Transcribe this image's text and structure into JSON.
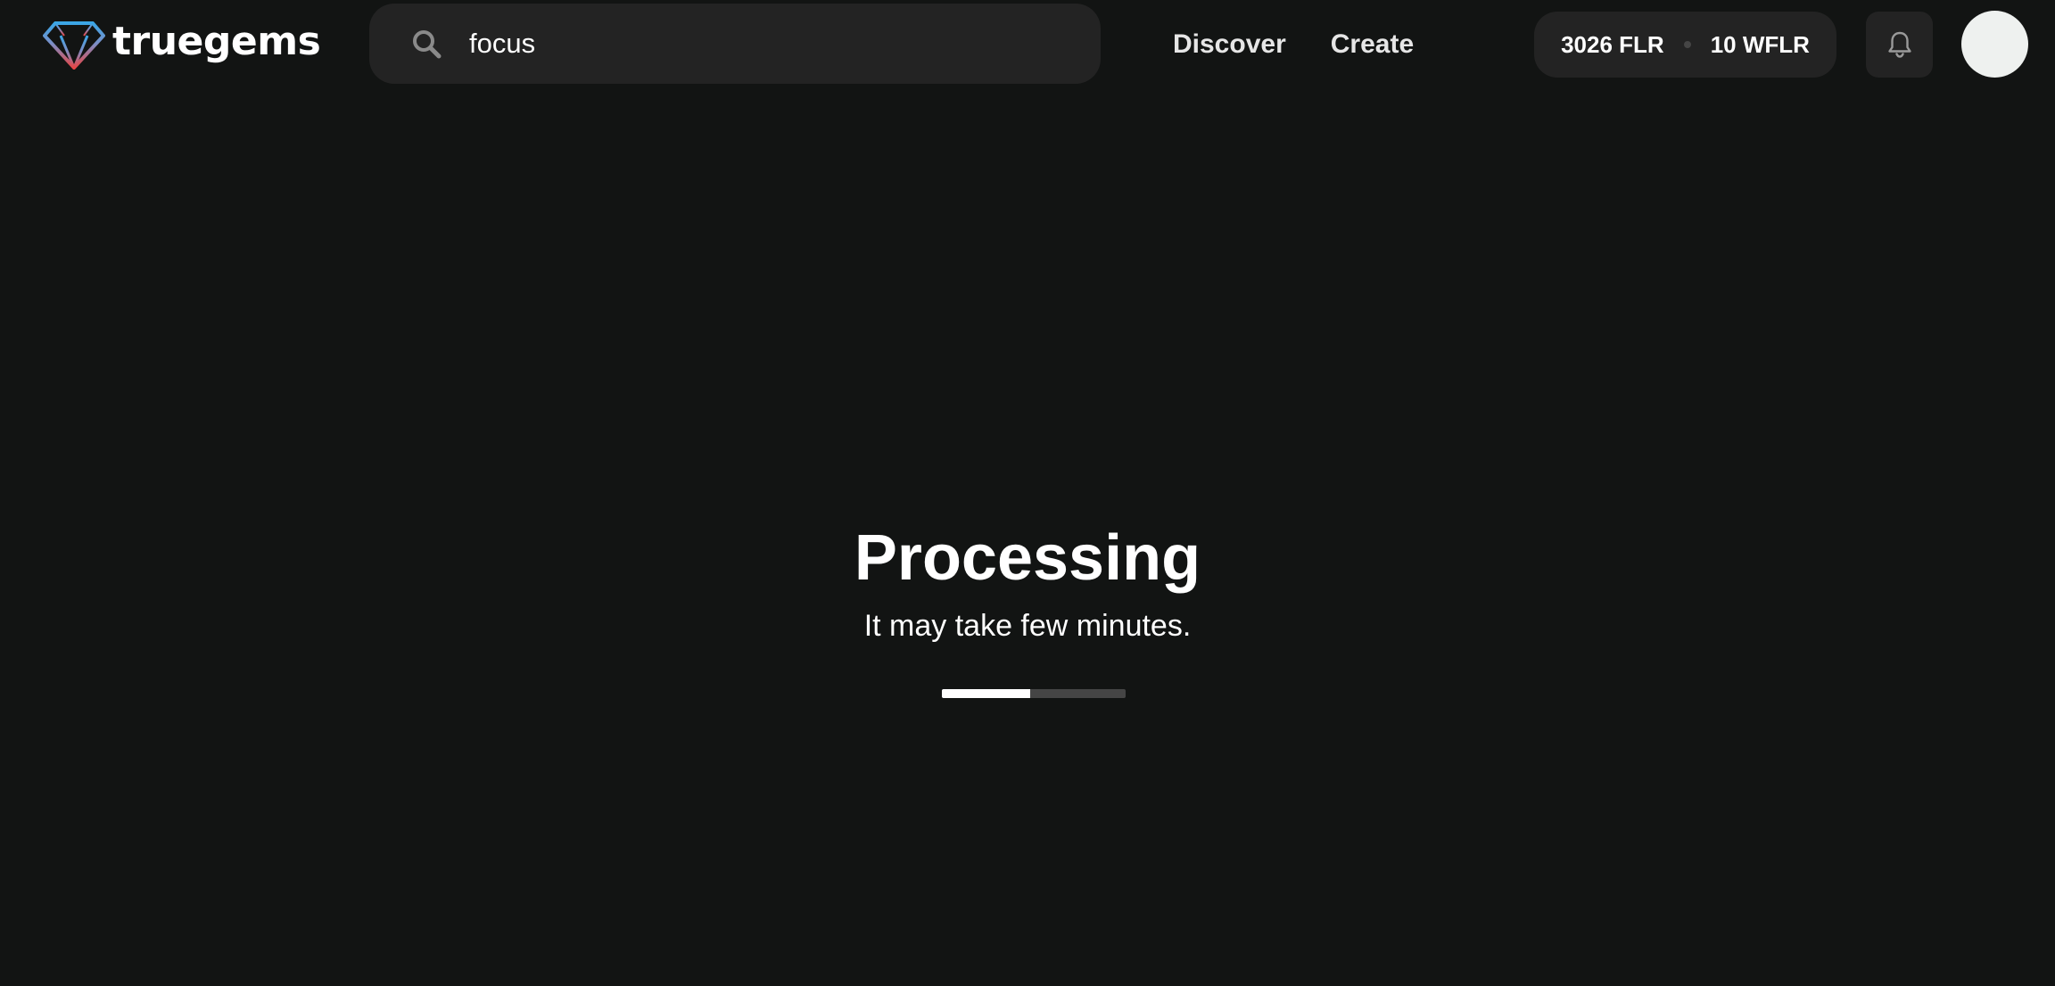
{
  "logo": {
    "text": "truegems",
    "accent_top": "#3aa6e6",
    "accent_bottom": "#e64545"
  },
  "search": {
    "value": "focus",
    "placeholder": ""
  },
  "nav": {
    "discover_label": "Discover",
    "create_label": "Create"
  },
  "balance": {
    "flr": "3026 FLR",
    "wflr": "10 WFLR"
  },
  "icons": {
    "search": "search-icon",
    "bell": "bell-icon",
    "logo": "gem-logo-icon"
  },
  "processing": {
    "title": "Processing",
    "subtitle": "It may take few minutes.",
    "progress_percent": 48
  },
  "colors": {
    "background": "#121413",
    "surface": "#232323",
    "text": "#ffffff",
    "progress_track": "#454545",
    "progress_fill": "#ffffff",
    "avatar": "#eef1ef"
  }
}
